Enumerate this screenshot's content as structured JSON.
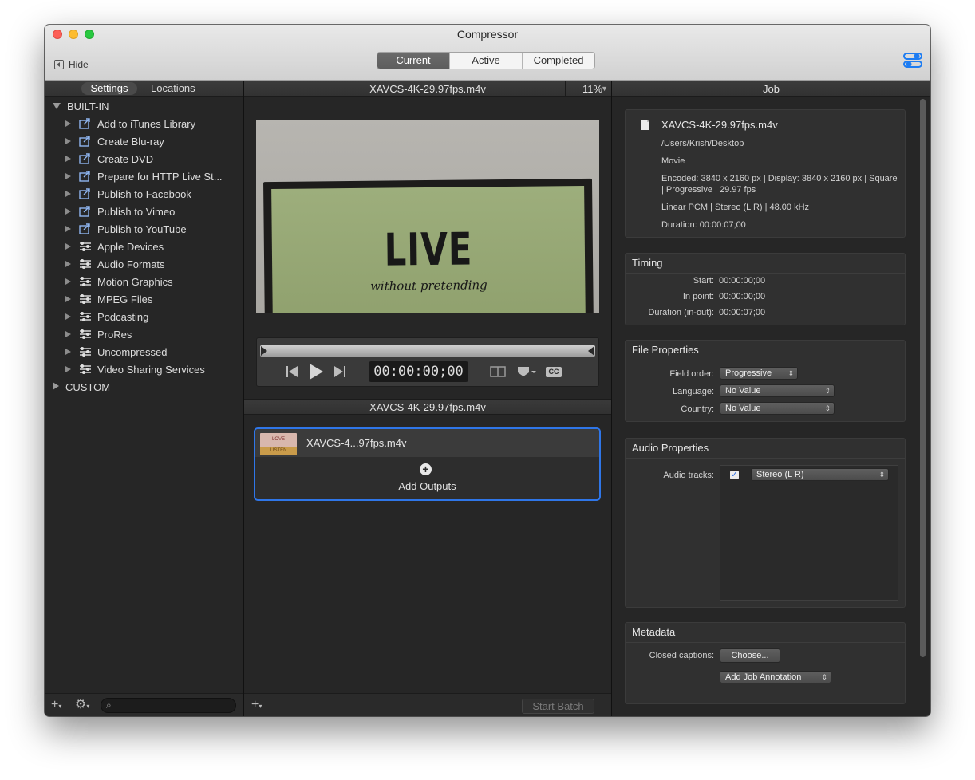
{
  "window": {
    "title": "Compressor",
    "hide_label": "Hide"
  },
  "toolbar": {
    "segments": [
      "Current",
      "Active",
      "Completed"
    ],
    "active_segment": "Current"
  },
  "sidebar": {
    "tabs": [
      "Settings",
      "Locations"
    ],
    "groups": {
      "builtin": "BUILT-IN",
      "custom": "CUSTOM"
    },
    "items": [
      {
        "label": "Add to iTunes Library",
        "icon": "share-icon"
      },
      {
        "label": "Create Blu-ray",
        "icon": "share-icon"
      },
      {
        "label": "Create DVD",
        "icon": "share-icon"
      },
      {
        "label": "Prepare for HTTP Live St...",
        "icon": "share-icon"
      },
      {
        "label": "Publish to Facebook",
        "icon": "share-icon"
      },
      {
        "label": "Publish to Vimeo",
        "icon": "share-icon"
      },
      {
        "label": "Publish to YouTube",
        "icon": "share-icon"
      },
      {
        "label": "Apple Devices",
        "icon": "settings-group-icon"
      },
      {
        "label": "Audio Formats",
        "icon": "settings-group-icon"
      },
      {
        "label": "Motion Graphics",
        "icon": "settings-group-icon"
      },
      {
        "label": "MPEG Files",
        "icon": "settings-group-icon"
      },
      {
        "label": "Podcasting",
        "icon": "settings-group-icon"
      },
      {
        "label": "ProRes",
        "icon": "settings-group-icon"
      },
      {
        "label": "Uncompressed",
        "icon": "settings-group-icon"
      },
      {
        "label": "Video Sharing Services",
        "icon": "settings-group-icon"
      }
    ]
  },
  "viewer": {
    "file": "XAVCS-4K-29.97fps.m4v",
    "zoom": "11%",
    "frame_text_big": "LIVE",
    "frame_text_small": "without pretending",
    "timecode": "00:00:00;00",
    "cc_label": "CC"
  },
  "batch": {
    "title": "XAVCS-4K-29.97fps.m4v",
    "job_name": "XAVCS-4...97fps.m4v",
    "thumb_top": "LOVE",
    "thumb_bottom": "LISTEN",
    "add_outputs": "Add Outputs",
    "start_batch": "Start Batch"
  },
  "inspector": {
    "header": "Job",
    "file": {
      "name": "XAVCS-4K-29.97fps.m4v",
      "path": "/Users/Krish/Desktop",
      "kind": "Movie",
      "encoded": "Encoded: 3840 x 2160 px | Display: 3840 x 2160 px | Square | Progressive | 29.97 fps",
      "audio": "Linear PCM | Stereo (L R) | 48.00 kHz",
      "duration": "Duration: 00:00:07;00"
    },
    "timing": {
      "title": "Timing",
      "start_label": "Start:",
      "start": "00:00:00;00",
      "in_label": "In point:",
      "in": "00:00:00;00",
      "dur_label": "Duration (in-out):",
      "dur": "00:00:07;00"
    },
    "file_props": {
      "title": "File Properties",
      "field_order_label": "Field order:",
      "field_order": "Progressive",
      "language_label": "Language:",
      "language": "No Value",
      "country_label": "Country:",
      "country": "No Value"
    },
    "audio_props": {
      "title": "Audio Properties",
      "tracks_label": "Audio tracks:",
      "track": "Stereo (L R)",
      "track_enabled": true
    },
    "metadata": {
      "title": "Metadata",
      "captions_label": "Closed captions:",
      "choose": "Choose...",
      "annotation": "Add Job Annotation"
    }
  },
  "colors": {
    "accent": "#2f76e8",
    "background": "#262626",
    "toolbar": "#dadada"
  }
}
